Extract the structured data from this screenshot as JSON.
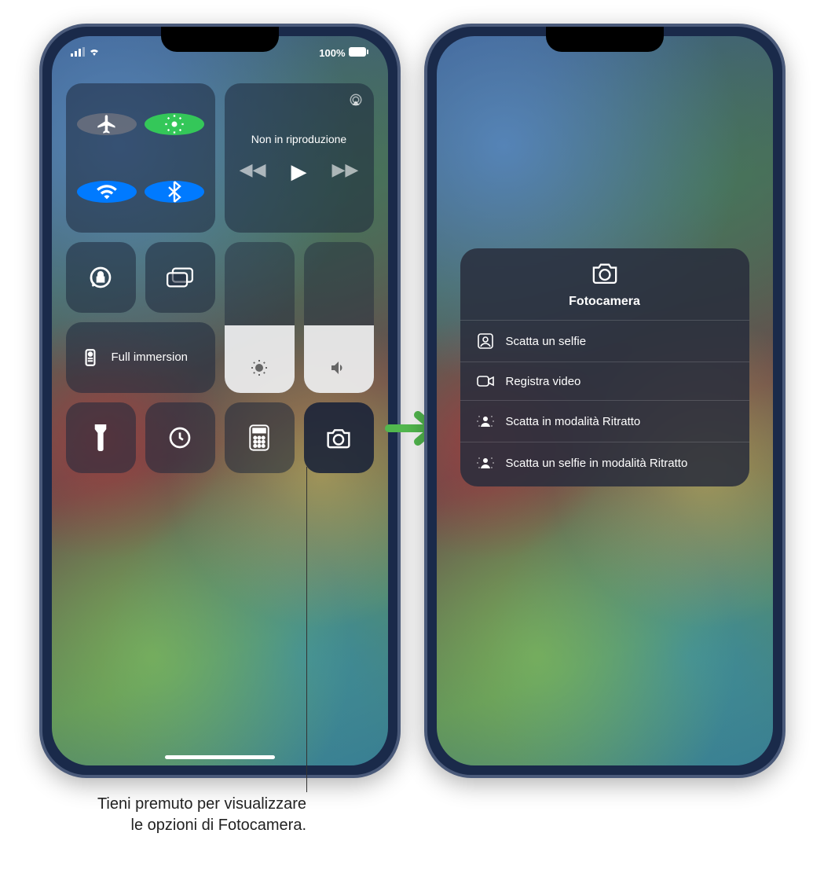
{
  "status": {
    "battery": "100%"
  },
  "media": {
    "now_playing_label": "Non in riproduzione"
  },
  "focus": {
    "label": "Full immersion"
  },
  "camera_menu": {
    "title": "Fotocamera",
    "items": [
      "Scatta un selfie",
      "Registra video",
      "Scatta in modalità Ritratto",
      "Scatta un selfie in modalità Ritratto"
    ]
  },
  "callout": {
    "text": "Tieni premuto per visualizzare le opzioni di Fotocamera."
  }
}
